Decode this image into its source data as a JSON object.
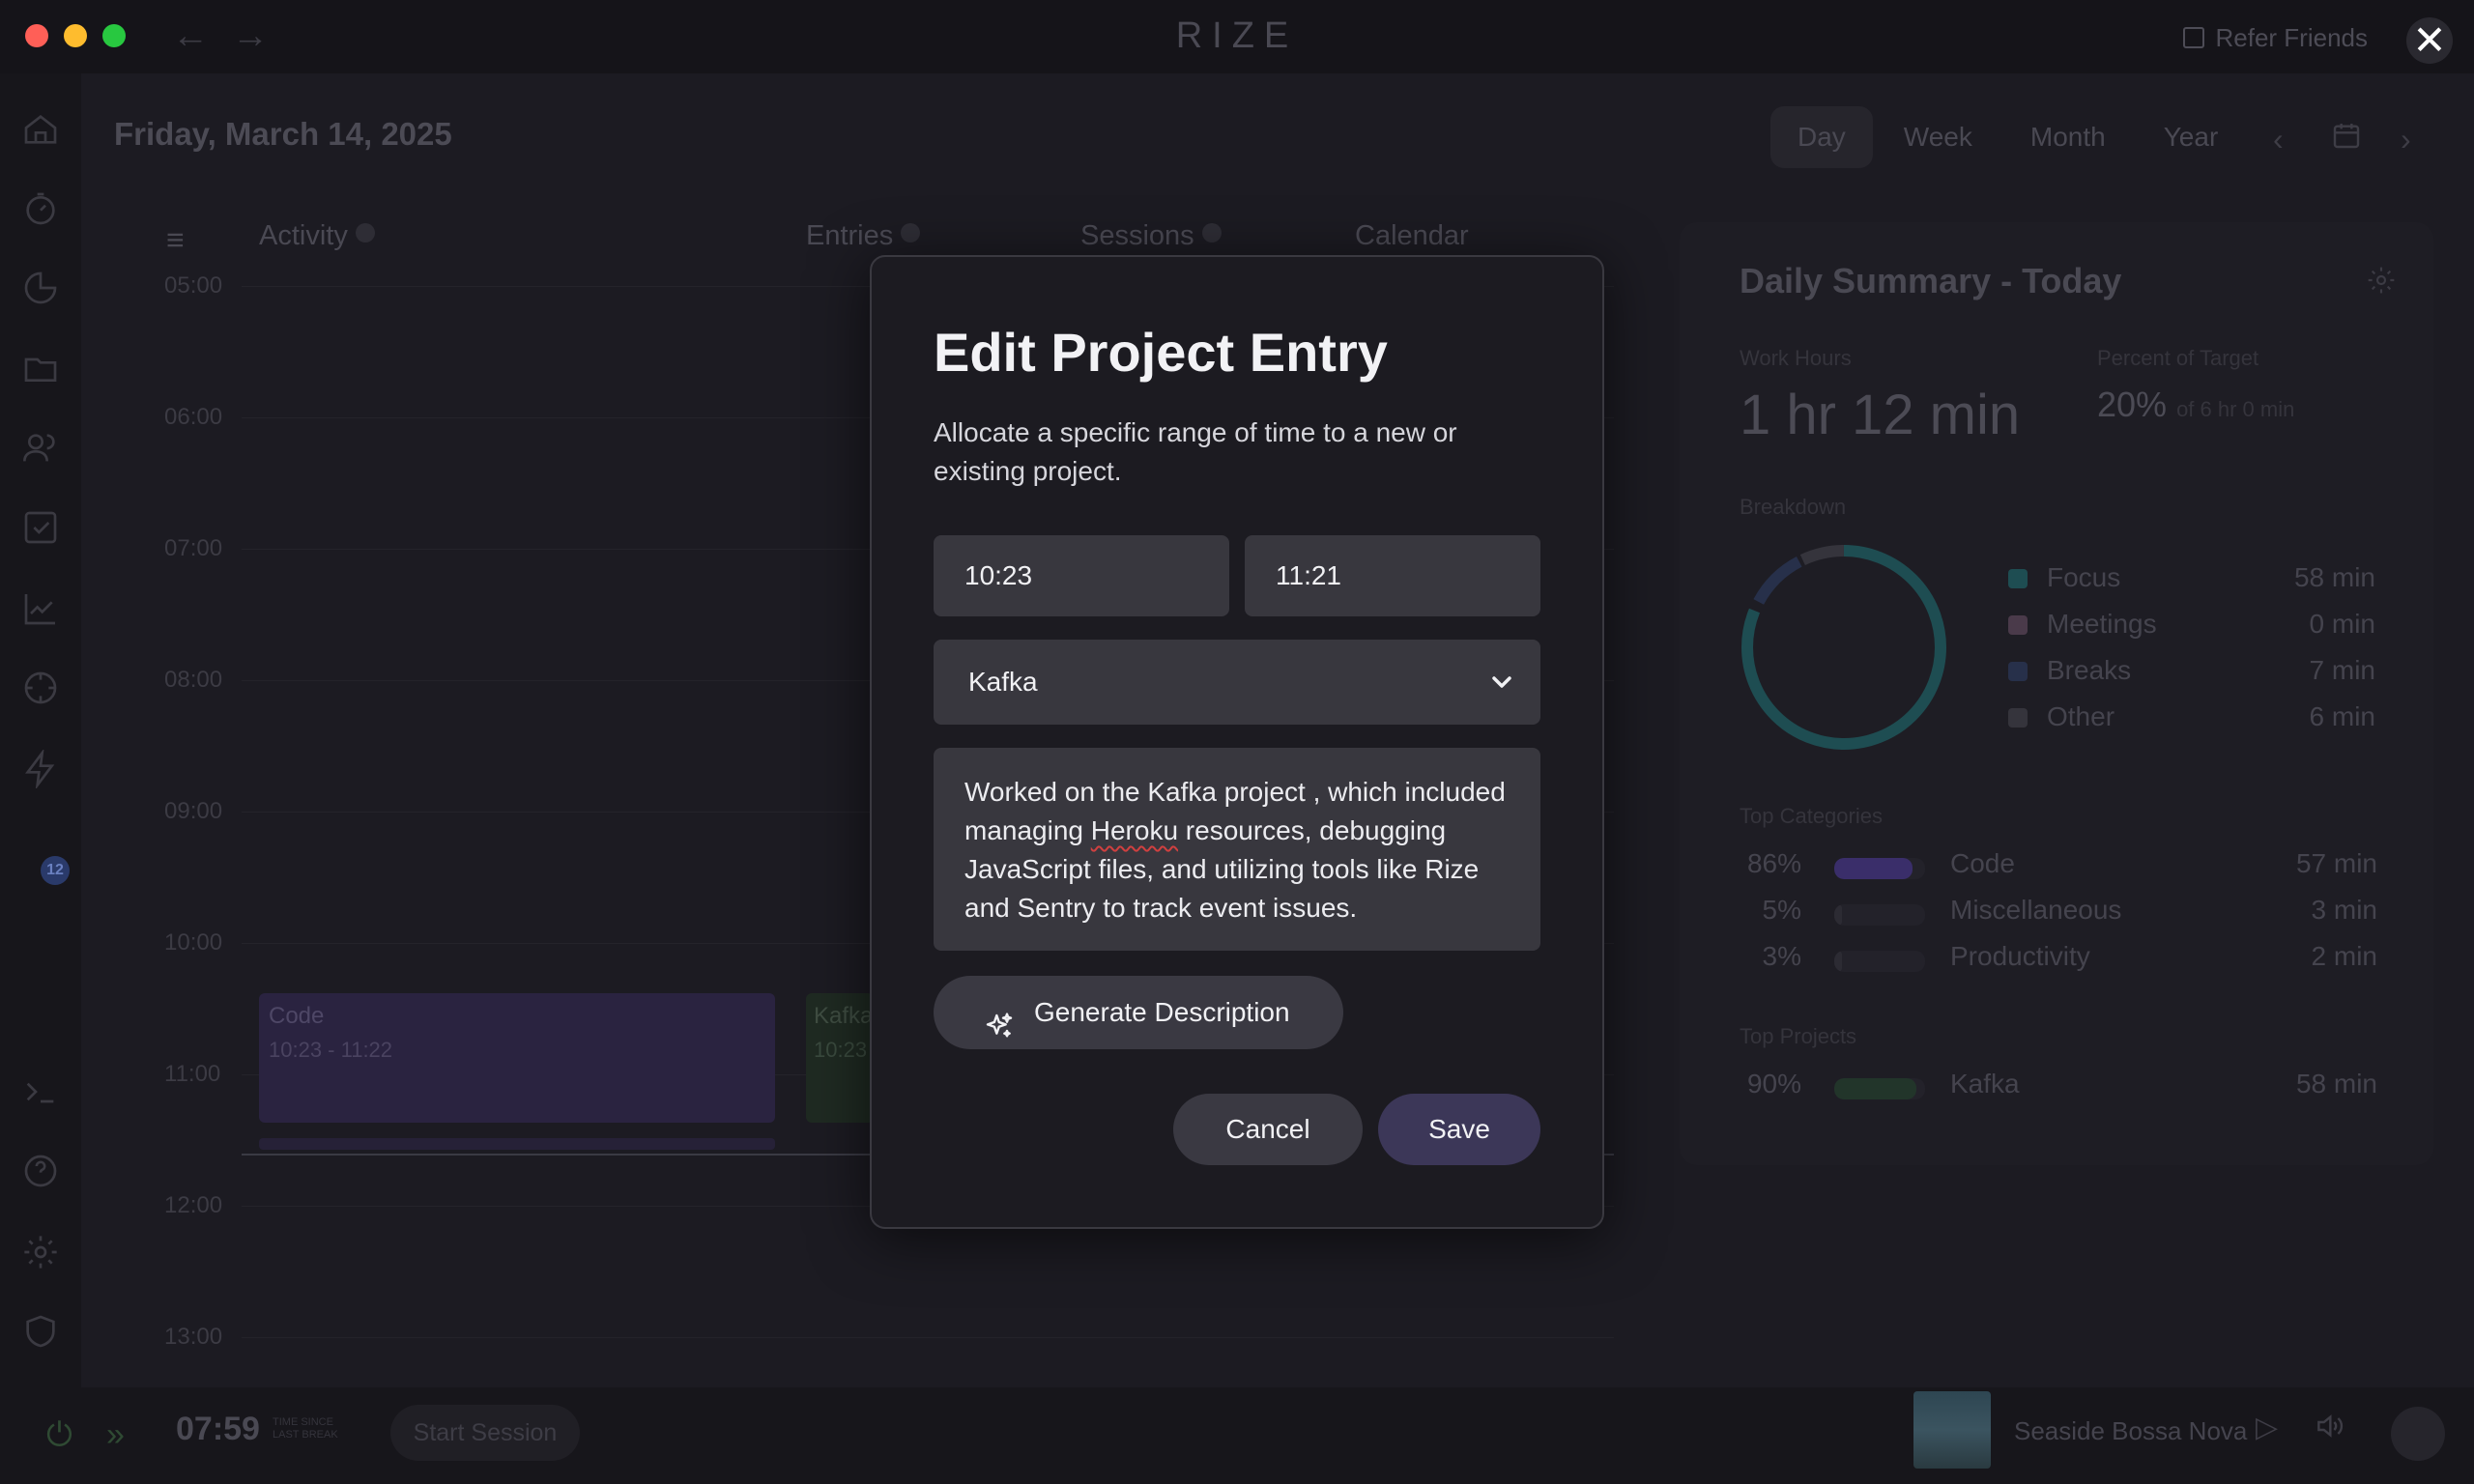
{
  "window": {
    "brand": "RIZE",
    "refer_friends": "Refer Friends",
    "close_glyph": "✕"
  },
  "header": {
    "date": "Friday, March 14, 2025",
    "tabs": [
      {
        "label": "Day",
        "active": true
      },
      {
        "label": "Week",
        "active": false
      },
      {
        "label": "Month",
        "active": false
      },
      {
        "label": "Year",
        "active": false
      }
    ]
  },
  "timeline": {
    "columns": {
      "activity": "Activity",
      "entries": "Entries",
      "sessions": "Sessions",
      "calendar": "Calendar"
    },
    "hours": [
      "05:00",
      "06:00",
      "07:00",
      "08:00",
      "09:00",
      "10:00",
      "11:00",
      "12:00",
      "13:00"
    ],
    "blocks": {
      "code": {
        "label": "Code",
        "time": "10:23 - 11:22"
      },
      "kafka": {
        "label": "Kafka",
        "time": "10:23"
      }
    }
  },
  "summary": {
    "title": "Daily Summary - Today",
    "work_hours_label": "Work Hours",
    "work_hours": "1 hr 12 min",
    "percent_label": "Percent of Target",
    "percent": "20%",
    "percent_sub": "of 6 hr 0 min",
    "breakdown_label": "Breakdown",
    "breakdown": [
      {
        "name": "Focus",
        "value": "58 min",
        "color": "#1e4d52"
      },
      {
        "name": "Meetings",
        "value": "0 min",
        "color": "#4a3a4a"
      },
      {
        "name": "Breaks",
        "value": "7 min",
        "color": "#27304a"
      },
      {
        "name": "Other",
        "value": "6 min",
        "color": "#35343c"
      }
    ],
    "top_categories_label": "Top Categories",
    "categories": [
      {
        "pct": "86%",
        "name": "Code",
        "value": "57 min",
        "fill": 0.86,
        "color": "#3a2e6a"
      },
      {
        "pct": "5%",
        "name": "Miscellaneous",
        "value": "3 min",
        "fill": 0.05,
        "color": "#2c2b33"
      },
      {
        "pct": "3%",
        "name": "Productivity",
        "value": "2 min",
        "fill": 0.03,
        "color": "#2c2b33"
      }
    ],
    "top_projects_label": "Top Projects",
    "projects": [
      {
        "pct": "90%",
        "name": "Kafka",
        "value": "58 min",
        "fill": 0.9,
        "color": "#22352a"
      }
    ]
  },
  "bottombar": {
    "timer": "07:59",
    "timer_sub_1": "TIME SINCE",
    "timer_sub_2": "LAST BREAK",
    "start_session": "Start Session",
    "track": "Seaside Bossa Nova"
  },
  "modal": {
    "title": "Edit Project Entry",
    "description": "Allocate a specific range of time to a new or existing project.",
    "start_time": "10:23",
    "end_time": "11:21",
    "project": "Kafka",
    "entry_text_1": "Worked on the Kafka project , which included managing ",
    "entry_text_spell": "Heroku",
    "entry_text_2": " resources, debugging JavaScript files, and utilizing tools like Rize and Sentry to track event issues.",
    "generate_label": "Generate Description",
    "cancel_label": "Cancel",
    "save_label": "Save"
  }
}
